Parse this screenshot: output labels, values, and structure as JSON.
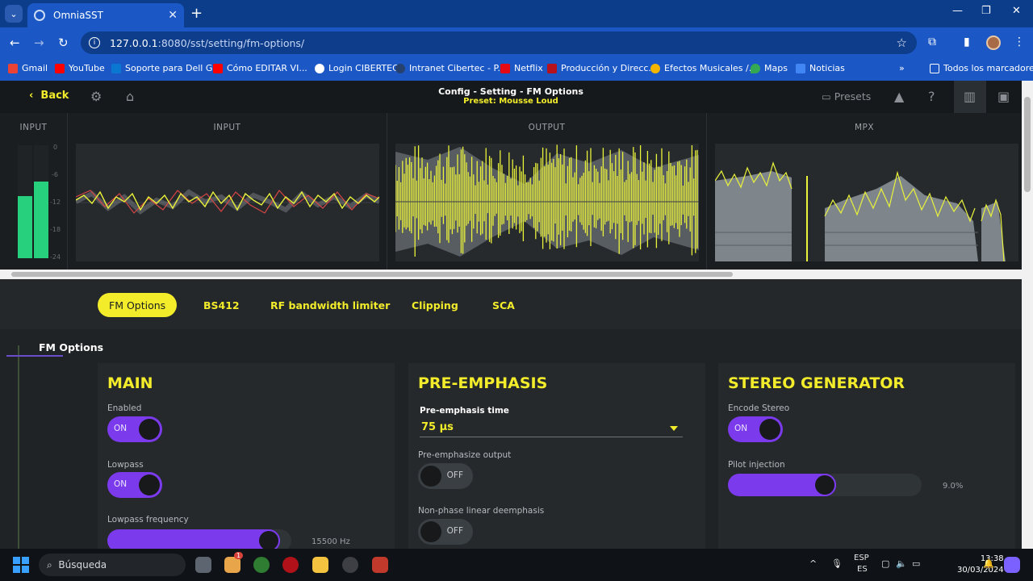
{
  "browser": {
    "tab_title": "OmniaSST",
    "url_host": "127.0.0.1",
    "url_path": ":8080/sst/setting/fm-options/",
    "bookmarks": [
      "Gmail",
      "YouTube",
      "Soporte para Dell G...",
      "Cómo EDITAR VI...",
      "Login CIBERTEC",
      "Intranet Cibertec - P...",
      "Netflix",
      "Producción y Direcc...",
      "Efectos Musicales /...",
      "Maps",
      "Noticias"
    ],
    "all_bookmarks": "Todos los marcadores"
  },
  "header": {
    "back": "Back",
    "title": "Config - Setting - FM Options",
    "preset": "Preset: Mousse Loud",
    "presets": "Presets"
  },
  "meters": {
    "vu_label": "INPUT",
    "vu_scale": [
      "0",
      "-6",
      "-12",
      "-18",
      "-24"
    ],
    "vu_levels": [
      0.55,
      0.68
    ],
    "panels": [
      "INPUT",
      "OUTPUT",
      "MPX"
    ]
  },
  "tabs": [
    "FM Options",
    "BS412",
    "RF bandwidth limiter",
    "Clipping",
    "SCA"
  ],
  "sidebar": {
    "item": "FM Options"
  },
  "main": {
    "title": "MAIN",
    "enabled_label": "Enabled",
    "enabled_state": "ON",
    "lowpass_label": "Lowpass",
    "lowpass_state": "ON",
    "lowpass_freq_label": "Lowpass frequency",
    "lowpass_freq_value": "15500 Hz",
    "lowpass_freq_fraction": 0.93
  },
  "pre_emphasis": {
    "title": "PRE-EMPHASIS",
    "time_label": "Pre-emphasis time",
    "time_value": "75 µs",
    "output_label": "Pre-emphasize output",
    "output_state": "OFF",
    "deemph_label": "Non-phase linear deemphasis",
    "deemph_state": "OFF"
  },
  "stereo": {
    "title": "STEREO GENERATOR",
    "encode_label": "Encode Stereo",
    "encode_state": "ON",
    "pilot_label": "Pilot injection",
    "pilot_value": "9.0%",
    "pilot_fraction": 0.5
  },
  "taskbar": {
    "search": "Búsqueda",
    "lang_top": "ESP",
    "lang_bottom": "ES",
    "time": "13:38",
    "date": "30/03/2024",
    "badge": "1"
  },
  "colors": {
    "accent": "#f2ec2b",
    "toggle": "#7c3aed",
    "vu": "#26d07c"
  }
}
